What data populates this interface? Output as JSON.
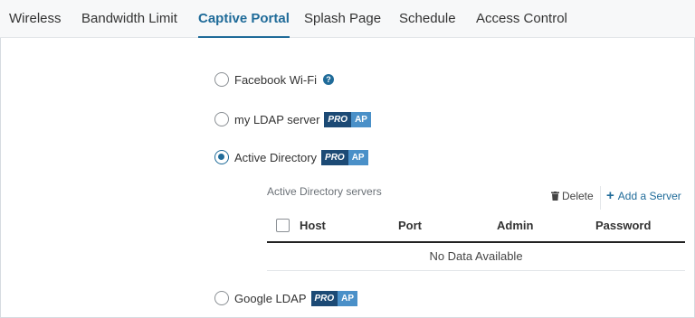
{
  "tabs": [
    {
      "label": "Wireless"
    },
    {
      "label": "Bandwidth Limit"
    },
    {
      "label": "Captive Portal"
    },
    {
      "label": "Splash Page"
    },
    {
      "label": "Schedule"
    },
    {
      "label": "Access Control"
    }
  ],
  "active_tab": "Captive Portal",
  "options": {
    "facebook": {
      "label": "Facebook Wi-Fi",
      "selected": false
    },
    "ldap": {
      "label": "my LDAP server",
      "selected": false
    },
    "active_directory": {
      "label": "Active Directory",
      "selected": true
    },
    "google_ldap": {
      "label": "Google LDAP",
      "selected": false
    }
  },
  "badge": {
    "pro": "PRO",
    "ap": "AP"
  },
  "help_glyph": "?",
  "servers": {
    "title": "Active Directory servers",
    "delete_label": "Delete",
    "add_label": "Add a Server",
    "columns": {
      "host": "Host",
      "port": "Port",
      "admin": "Admin",
      "password": "Password"
    },
    "empty_text": "No Data Available"
  },
  "colors": {
    "accent": "#1f6b99",
    "badge_pro": "#1c4a75",
    "badge_ap": "#4a90c8"
  }
}
